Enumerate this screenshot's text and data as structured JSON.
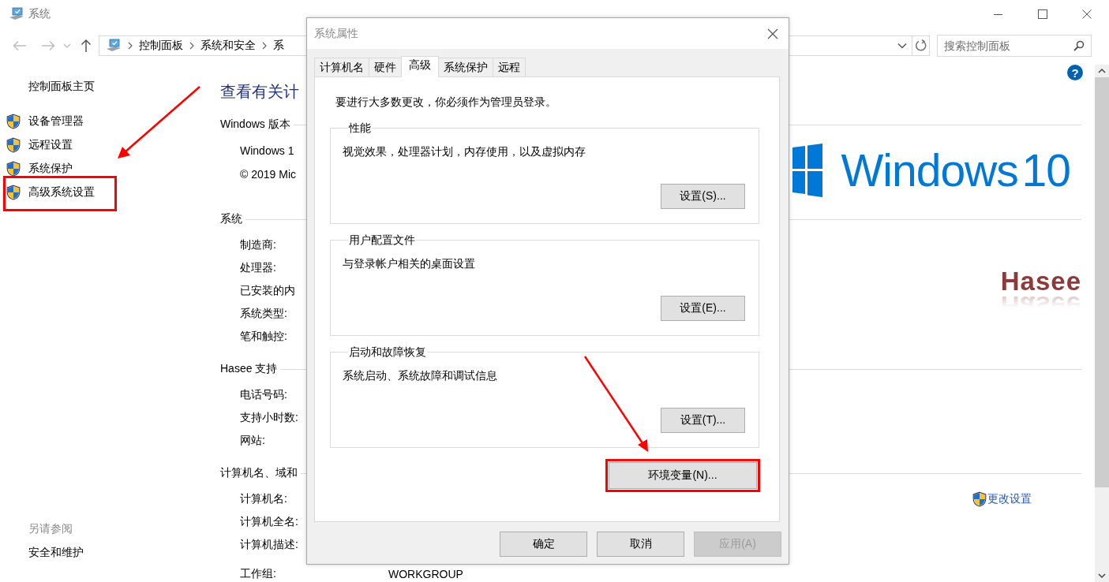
{
  "window": {
    "title": "系统"
  },
  "navigation": {
    "breadcrumbs": [
      "控制面板",
      "系统和安全",
      "系"
    ]
  },
  "search": {
    "placeholder": "搜索控制面板"
  },
  "help": "?",
  "sidebar": {
    "home": "控制面板主页",
    "tasks": [
      {
        "label": "设备管理器",
        "highlighted": false
      },
      {
        "label": "远程设置",
        "highlighted": false
      },
      {
        "label": "系统保护",
        "highlighted": false
      },
      {
        "label": "高级系统设置",
        "highlighted": true
      }
    ],
    "see_also_heading": "另请参阅",
    "see_also": [
      "安全和维护"
    ]
  },
  "main": {
    "title": "查看有关计",
    "sections": [
      {
        "heading": "Windows 版本",
        "rows": [
          {
            "label": "Windows 1"
          },
          {
            "label": "© 2019 Mic"
          }
        ],
        "aside": {
          "kind": "windows_logo",
          "text": "Windows 10"
        }
      },
      {
        "heading": "系统",
        "rows": [
          {
            "label": "制造商:"
          },
          {
            "label": "处理器:"
          },
          {
            "label": "已安装的内"
          },
          {
            "label": "系统类型:"
          },
          {
            "label": "笔和触控:"
          }
        ],
        "aside": {
          "kind": "oem_logo",
          "text": "Hasee"
        }
      },
      {
        "heading": "Hasee 支持",
        "rows": [
          {
            "label": "电话号码:"
          },
          {
            "label": "支持小时数:"
          },
          {
            "label": "网站:"
          }
        ]
      },
      {
        "heading": "计算机名、域和",
        "rows": [
          {
            "label": "计算机名:"
          },
          {
            "label": "计算机全名:"
          },
          {
            "label": "计算机描述:"
          },
          {
            "label": "工作组:",
            "value": "WORKGROUP"
          }
        ],
        "aside": {
          "kind": "link",
          "text": "更改设置"
        }
      }
    ]
  },
  "dialog": {
    "title": "系统属性",
    "tabs": [
      {
        "label": "计算机名",
        "selected": false
      },
      {
        "label": "硬件",
        "selected": false
      },
      {
        "label": "高级",
        "selected": true
      },
      {
        "label": "系统保护",
        "selected": false
      },
      {
        "label": "远程",
        "selected": false
      }
    ],
    "note": "要进行大多数更改，你必须作为管理员登录。",
    "groups": [
      {
        "title": "性能",
        "description": "视觉效果，处理器计划，内存使用，以及虚拟内存",
        "button": "设置(S)..."
      },
      {
        "title": "用户配置文件",
        "description": "与登录帐户相关的桌面设置",
        "button": "设置(E)..."
      },
      {
        "title": "启动和故障恢复",
        "description": "系统启动、系统故障和调试信息",
        "button": "设置(T)..."
      }
    ],
    "env_button": {
      "label": "环境变量(N)...",
      "highlighted": true
    },
    "buttons": [
      {
        "label": "确定",
        "disabled": false
      },
      {
        "label": "取消",
        "disabled": false
      },
      {
        "label": "应用(A)",
        "disabled": true
      }
    ]
  }
}
